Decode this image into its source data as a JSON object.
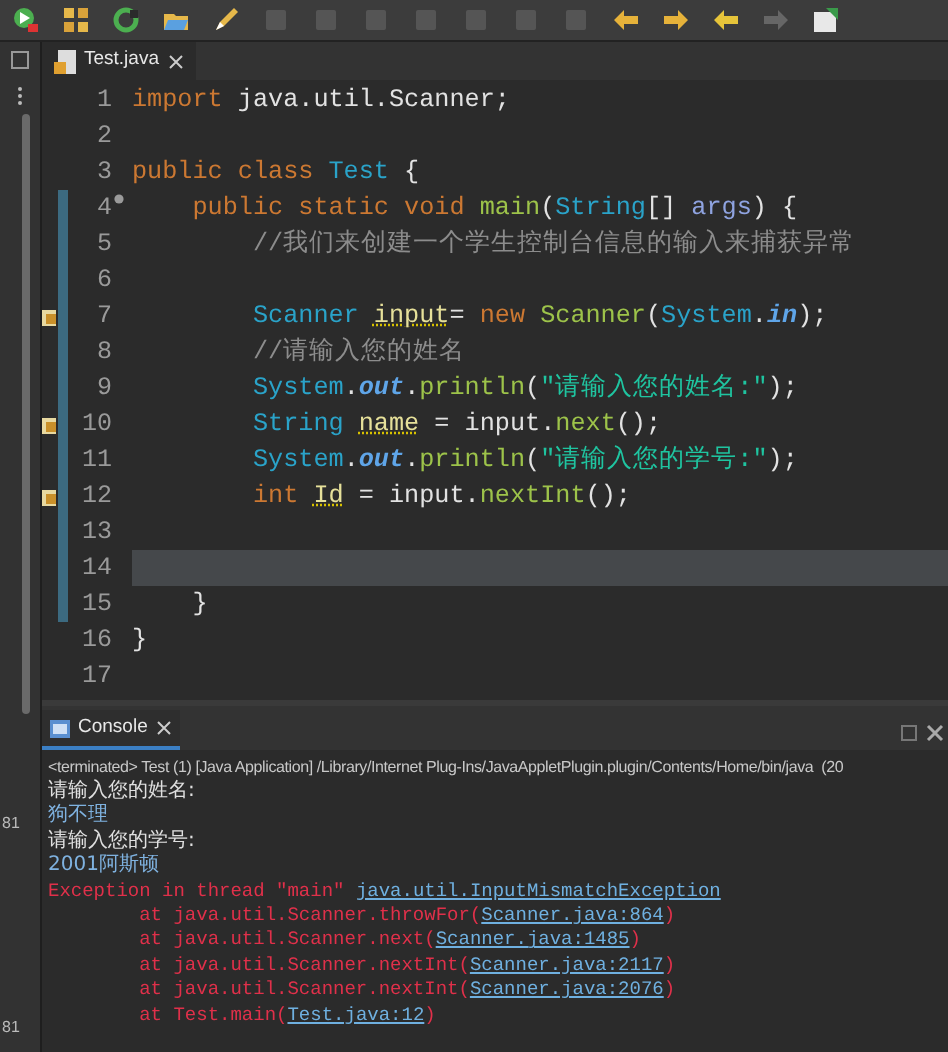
{
  "editor_tab": {
    "label": "Test.java",
    "selected": true
  },
  "code_lines": [
    {
      "number": "1",
      "warning": false,
      "override": false,
      "changed": false,
      "current": false,
      "tokens": [
        {
          "kind": "kw",
          "text": "import"
        },
        {
          "kind": "plain",
          "text": " java.util.Scanner;"
        }
      ]
    },
    {
      "number": "2",
      "warning": false,
      "override": false,
      "changed": false,
      "current": false
    },
    {
      "number": "3",
      "warning": false,
      "override": false,
      "changed": false,
      "current": false,
      "tokens": [
        {
          "kind": "kw",
          "text": "public class "
        },
        {
          "kind": "type",
          "text": "Test"
        },
        {
          "kind": "plain",
          "text": " {"
        }
      ]
    },
    {
      "number": "4",
      "warning": false,
      "override": true,
      "changed": true,
      "current": false,
      "tokens": [
        {
          "kind": "kw",
          "text": "    public static void "
        },
        {
          "kind": "method",
          "text": "main"
        },
        {
          "kind": "plain",
          "text": "("
        },
        {
          "kind": "type",
          "text": "String"
        },
        {
          "kind": "plain",
          "text": "[] "
        },
        {
          "kind": "param",
          "text": "args"
        },
        {
          "kind": "plain",
          "text": ") {"
        }
      ]
    },
    {
      "number": "5",
      "warning": false,
      "override": false,
      "changed": true,
      "current": false,
      "tokens": [
        {
          "kind": "comment",
          "text": "        //我们来创建一个学生控制台信息的输入来捕获异常"
        }
      ]
    },
    {
      "number": "6",
      "warning": false,
      "override": false,
      "changed": true,
      "current": false
    },
    {
      "number": "7",
      "warning": true,
      "override": false,
      "changed": true,
      "current": false,
      "tokens": [
        {
          "kind": "type",
          "text": "        Scanner "
        },
        {
          "kind": "local",
          "text": "input"
        },
        {
          "kind": "plain",
          "text": "= "
        },
        {
          "kind": "kw",
          "text": "new "
        },
        {
          "kind": "method",
          "text": "Scanner"
        },
        {
          "kind": "plain",
          "text": "("
        },
        {
          "kind": "type",
          "text": "System"
        },
        {
          "kind": "plain",
          "text": "."
        },
        {
          "kind": "field",
          "text": "in"
        },
        {
          "kind": "plain",
          "text": ");"
        }
      ]
    },
    {
      "number": "8",
      "warning": false,
      "override": false,
      "changed": true,
      "current": false,
      "tokens": [
        {
          "kind": "comment",
          "text": "        //请输入您的姓名"
        }
      ]
    },
    {
      "number": "9",
      "warning": false,
      "override": false,
      "changed": true,
      "current": false,
      "tokens": [
        {
          "kind": "type",
          "text": "        System"
        },
        {
          "kind": "plain",
          "text": "."
        },
        {
          "kind": "field",
          "text": "out"
        },
        {
          "kind": "plain",
          "text": "."
        },
        {
          "kind": "method",
          "text": "println"
        },
        {
          "kind": "plain",
          "text": "("
        },
        {
          "kind": "string",
          "text": "\"请输入您的姓名:\""
        },
        {
          "kind": "plain",
          "text": ");"
        }
      ]
    },
    {
      "number": "10",
      "warning": true,
      "override": false,
      "changed": true,
      "current": false,
      "tokens": [
        {
          "kind": "type",
          "text": "        String "
        },
        {
          "kind": "local",
          "text": "name"
        },
        {
          "kind": "plain",
          "text": " = input."
        },
        {
          "kind": "method",
          "text": "next"
        },
        {
          "kind": "plain",
          "text": "();"
        }
      ]
    },
    {
      "number": "11",
      "warning": false,
      "override": false,
      "changed": true,
      "current": false,
      "tokens": [
        {
          "kind": "type",
          "text": "        System"
        },
        {
          "kind": "plain",
          "text": "."
        },
        {
          "kind": "field",
          "text": "out"
        },
        {
          "kind": "plain",
          "text": "."
        },
        {
          "kind": "method",
          "text": "println"
        },
        {
          "kind": "plain",
          "text": "("
        },
        {
          "kind": "string",
          "text": "\"请输入您的学号:\""
        },
        {
          "kind": "plain",
          "text": ");"
        }
      ]
    },
    {
      "number": "12",
      "warning": true,
      "override": false,
      "changed": true,
      "current": false,
      "tokens": [
        {
          "kind": "kw",
          "text": "        int "
        },
        {
          "kind": "local",
          "text": "Id"
        },
        {
          "kind": "plain",
          "text": " = input."
        },
        {
          "kind": "method",
          "text": "nextInt"
        },
        {
          "kind": "plain",
          "text": "();"
        }
      ]
    },
    {
      "number": "13",
      "warning": false,
      "override": false,
      "changed": true,
      "current": false
    },
    {
      "number": "14",
      "warning": false,
      "override": false,
      "changed": true,
      "current": true
    },
    {
      "number": "15",
      "warning": false,
      "override": false,
      "changed": true,
      "current": false,
      "tokens": [
        {
          "kind": "plain",
          "text": "    }"
        }
      ]
    },
    {
      "number": "16",
      "warning": false,
      "override": false,
      "changed": false,
      "current": false,
      "tokens": [
        {
          "kind": "plain",
          "text": "}"
        }
      ]
    },
    {
      "number": "17",
      "warning": false,
      "override": false,
      "changed": false,
      "current": false
    }
  ],
  "console": {
    "tab": {
      "label": "Console",
      "selected": true
    },
    "status": "<terminated> Test (1) [Java Application] /Library/Internet Plug-Ins/JavaAppletPlugin.plugin/Contents/Home/bin/java  (20",
    "lines": [
      {
        "kind": "stdout",
        "segments": [
          {
            "kind": "text",
            "text": "请输入您的姓名:"
          }
        ]
      },
      {
        "kind": "stdin",
        "segments": [
          {
            "kind": "text",
            "text": "狗不理"
          }
        ]
      },
      {
        "kind": "stdout",
        "segments": [
          {
            "kind": "text",
            "text": "请输入您的学号:"
          }
        ]
      },
      {
        "kind": "stdin",
        "segments": [
          {
            "kind": "text",
            "text": "2001阿斯顿"
          }
        ]
      },
      {
        "kind": "error",
        "segments": [
          {
            "kind": "text",
            "text": "Exception in thread \"main\" "
          },
          {
            "kind": "link",
            "text": "java.util.InputMismatchException"
          }
        ]
      },
      {
        "kind": "error",
        "segments": [
          {
            "kind": "text",
            "text": "        at java.util.Scanner.throwFor("
          },
          {
            "kind": "link",
            "text": "Scanner.java:864"
          },
          {
            "kind": "text",
            "text": ")"
          }
        ]
      },
      {
        "kind": "error",
        "segments": [
          {
            "kind": "text",
            "text": "        at java.util.Scanner.next("
          },
          {
            "kind": "link",
            "text": "Scanner.java:1485"
          },
          {
            "kind": "text",
            "text": ")"
          }
        ]
      },
      {
        "kind": "error",
        "segments": [
          {
            "kind": "text",
            "text": "        at java.util.Scanner.nextInt("
          },
          {
            "kind": "link",
            "text": "Scanner.java:2117"
          },
          {
            "kind": "text",
            "text": ")"
          }
        ]
      },
      {
        "kind": "error",
        "segments": [
          {
            "kind": "text",
            "text": "        at java.util.Scanner.nextInt("
          },
          {
            "kind": "link",
            "text": "Scanner.java:2076"
          },
          {
            "kind": "text",
            "text": ")"
          }
        ]
      },
      {
        "kind": "error",
        "segments": [
          {
            "kind": "text",
            "text": "        at Test.main("
          },
          {
            "kind": "link",
            "text": "Test.java:12"
          },
          {
            "kind": "text",
            "text": ")"
          }
        ]
      }
    ]
  },
  "side_fragments": [
    "81",
    "81"
  ]
}
